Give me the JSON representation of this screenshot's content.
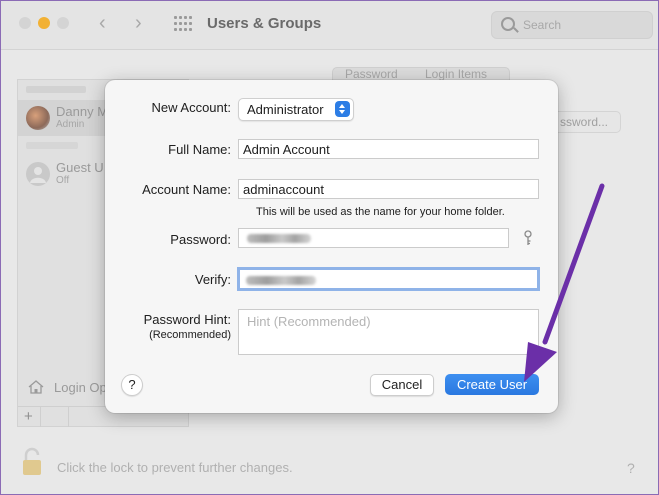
{
  "window": {
    "title": "Users & Groups",
    "search_placeholder": "Search"
  },
  "sidebar": {
    "users": [
      {
        "name": "Danny M",
        "role": "Admin"
      },
      {
        "name": "Guest U",
        "role": "Off"
      }
    ],
    "login_options_label": "Login Op",
    "add_label": "+"
  },
  "background": {
    "tabs": [
      "Password",
      "Login Items"
    ],
    "change_password_label": "ssword...",
    "lock_text": "Click the lock to prevent further changes.",
    "help_label": "?"
  },
  "dialog": {
    "new_account_label": "New Account:",
    "new_account_value": "Administrator",
    "full_name_label": "Full Name:",
    "full_name_value": "Admin Account",
    "account_name_label": "Account Name:",
    "account_name_value": "adminaccount",
    "account_name_note": "This will be used as the name for your home folder.",
    "password_label": "Password:",
    "verify_label": "Verify:",
    "hint_label": "Password Hint:",
    "hint_sublabel": "(Recommended)",
    "hint_placeholder": "Hint (Recommended)",
    "help_label": "?",
    "cancel_label": "Cancel",
    "create_label": "Create User"
  },
  "colors": {
    "accent": "#2a7de1",
    "annotation_arrow": "#6b2fa8"
  }
}
